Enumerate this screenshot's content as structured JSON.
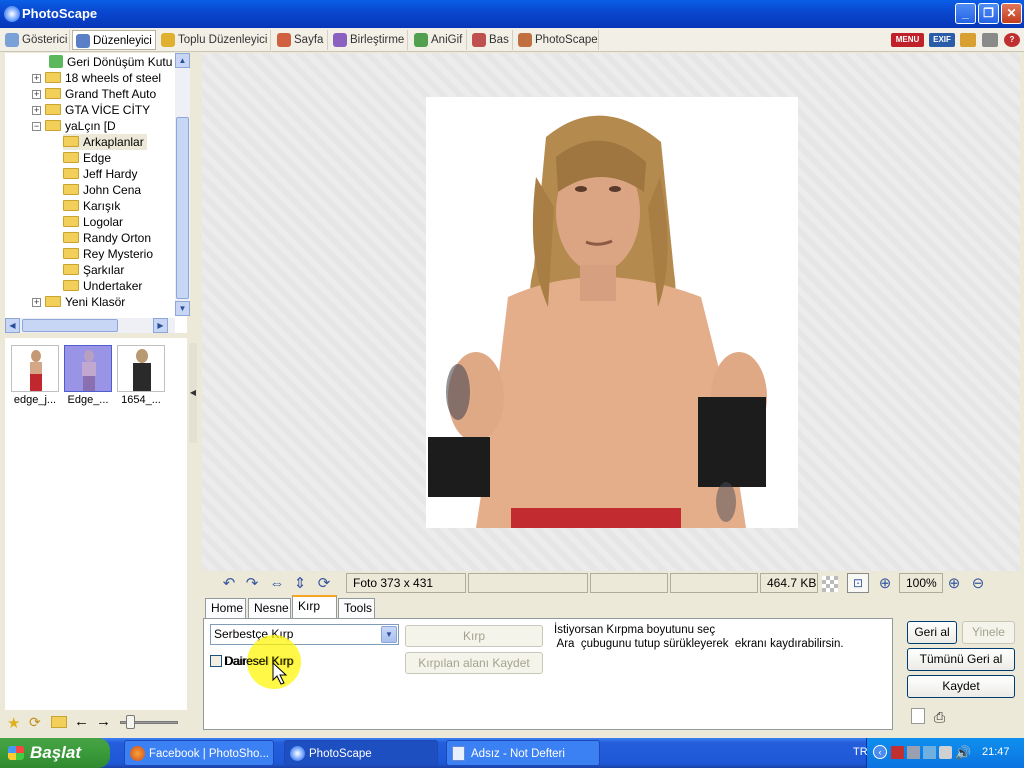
{
  "window": {
    "title": "PhotoScape"
  },
  "mode_tabs": [
    "Gösterici",
    "Düzenleyici",
    "Toplu Düzenleyici",
    "Sayfa",
    "Birleştirme",
    "AniGif",
    "Bas",
    "PhotoScape"
  ],
  "right_badges": {
    "menu": "MENU",
    "exif": "EXIF"
  },
  "tree": {
    "items": [
      {
        "label": "Geri Dönüşüm Kutu"
      },
      {
        "label": "18 wheels of steel"
      },
      {
        "label": "Grand Theft Auto"
      },
      {
        "label": "GTA VİCE CİTY"
      },
      {
        "label": "yaLçın [D"
      },
      {
        "label": "Arkaplanlar"
      },
      {
        "label": "Edge"
      },
      {
        "label": "Jeff Hardy"
      },
      {
        "label": "John Cena"
      },
      {
        "label": "Karışık"
      },
      {
        "label": "Logolar"
      },
      {
        "label": "Randy Orton"
      },
      {
        "label": "Rey Mysterio"
      },
      {
        "label": "Şarkılar"
      },
      {
        "label": "Undertaker"
      },
      {
        "label": "Yeni Klasör"
      }
    ]
  },
  "thumbnails": [
    {
      "label": "edge_j..."
    },
    {
      "label": "Edge_..."
    },
    {
      "label": "1654_..."
    }
  ],
  "status": {
    "photo_size": "Foto 373 x 431",
    "file_size": "464.7 KB",
    "zoom": "100%"
  },
  "edit_tabs": [
    "Home",
    "Nesne",
    "Kırp",
    "Tools"
  ],
  "crop": {
    "mode": "Serbestçe Kırp",
    "crop_button": "Kırp",
    "save_crop_button": "Kırpılan alanı Kaydet",
    "circle_crop": "Dairesel Kırp",
    "hint_line1": "İstiyorsan Kırpma boyutunu seç",
    "hint_line2": " Ara  çubugunu tutup sürükleyerek  ekranı kaydırabilirsin."
  },
  "actions": {
    "undo": "Geri al",
    "redo": "Yinele",
    "undo_all": "Tümünü Geri al",
    "save": "Kaydet"
  },
  "taskbar": {
    "start": "Başlat",
    "tasks": [
      "Facebook | PhotoSho...",
      "PhotoScape",
      "Adsız - Not Defteri"
    ],
    "lang": "TR",
    "clock": "21:47"
  }
}
